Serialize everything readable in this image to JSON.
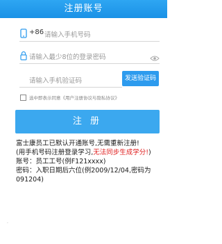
{
  "header": {
    "title": "注册账号"
  },
  "phone": {
    "prefix": "+86",
    "placeholder": "请输入手机号码"
  },
  "password": {
    "placeholder": "请输入最少8位的登录密码"
  },
  "code": {
    "placeholder": "请输入手机验证码",
    "send_label": "发送验证码"
  },
  "agreement": {
    "label": "选中即表示同意《用户注册协议与隐私协议》"
  },
  "register": {
    "label": "注 册"
  },
  "notice": {
    "line1": "富士康员工已默认开通账号,无需重新注册!",
    "line2_prefix": "(用手机号码注册登录学习,",
    "line2_red": "无法同步生成学分!",
    "line2_suffix": ")",
    "line3": "账号：员工工号(例F121xxxx)",
    "line4": "密码：入职日期后六位(例2009/12/04,密码为",
    "line5": "091204)"
  },
  "footer": {
    "dot": "."
  },
  "colors": {
    "accent": "#2d9bee",
    "warning": "#e02020"
  },
  "icons": [
    "phone-icon",
    "lock-icon",
    "eye-icon"
  ]
}
